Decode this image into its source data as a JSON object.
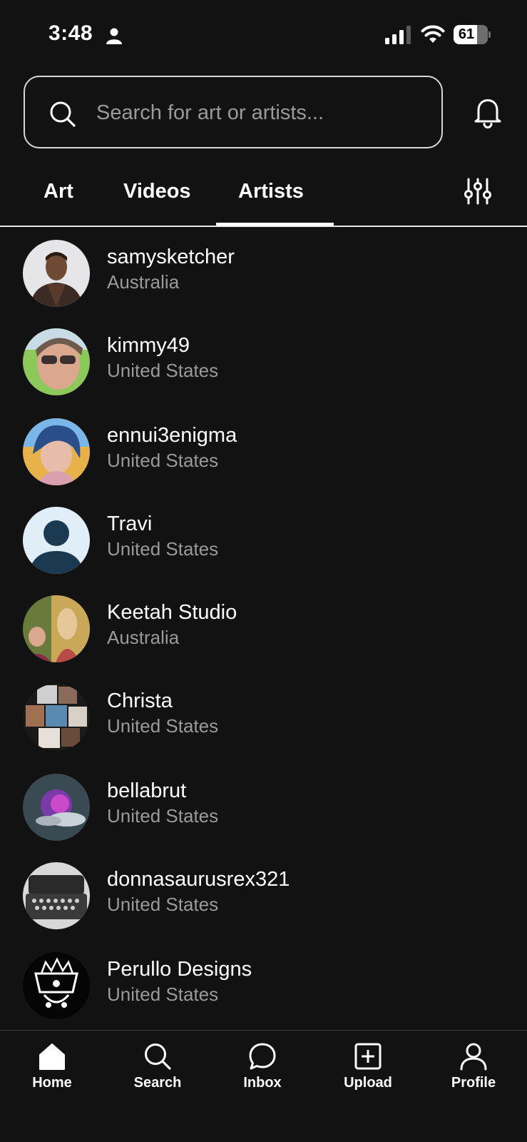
{
  "status_bar": {
    "time": "3:48",
    "battery_percent": "61",
    "person_icon": "person-icon",
    "signal_icon": "cellular-signal-icon",
    "wifi_icon": "wifi-icon"
  },
  "search": {
    "placeholder": "Search for art or artists...",
    "icon": "search-icon"
  },
  "notifications": {
    "icon": "bell-icon"
  },
  "tabs": [
    {
      "label": "Art",
      "active": false
    },
    {
      "label": "Videos",
      "active": false
    },
    {
      "label": "Artists",
      "active": true
    }
  ],
  "filter": {
    "icon": "sliders-icon"
  },
  "artists": [
    {
      "name": "samysketcher",
      "country": "Australia"
    },
    {
      "name": "kimmy49",
      "country": "United States"
    },
    {
      "name": "ennui3enigma",
      "country": "United States"
    },
    {
      "name": "Travi",
      "country": "United States"
    },
    {
      "name": "Keetah Studio",
      "country": "Australia"
    },
    {
      "name": "Christa",
      "country": "United States"
    },
    {
      "name": "bellabrut",
      "country": "United States"
    },
    {
      "name": "donnasaurusrex321",
      "country": "United States"
    },
    {
      "name": "Perullo Designs",
      "country": "United States"
    }
  ],
  "bottom_nav": {
    "home": "Home",
    "search": "Search",
    "inbox": "Inbox",
    "upload": "Upload",
    "profile": "Profile"
  },
  "colors": {
    "background": "#121212",
    "text_primary": "#ffffff",
    "text_secondary": "#9a9a9a",
    "default_avatar_bg": "#dfeef7",
    "default_avatar_fg": "#1b3a52"
  }
}
